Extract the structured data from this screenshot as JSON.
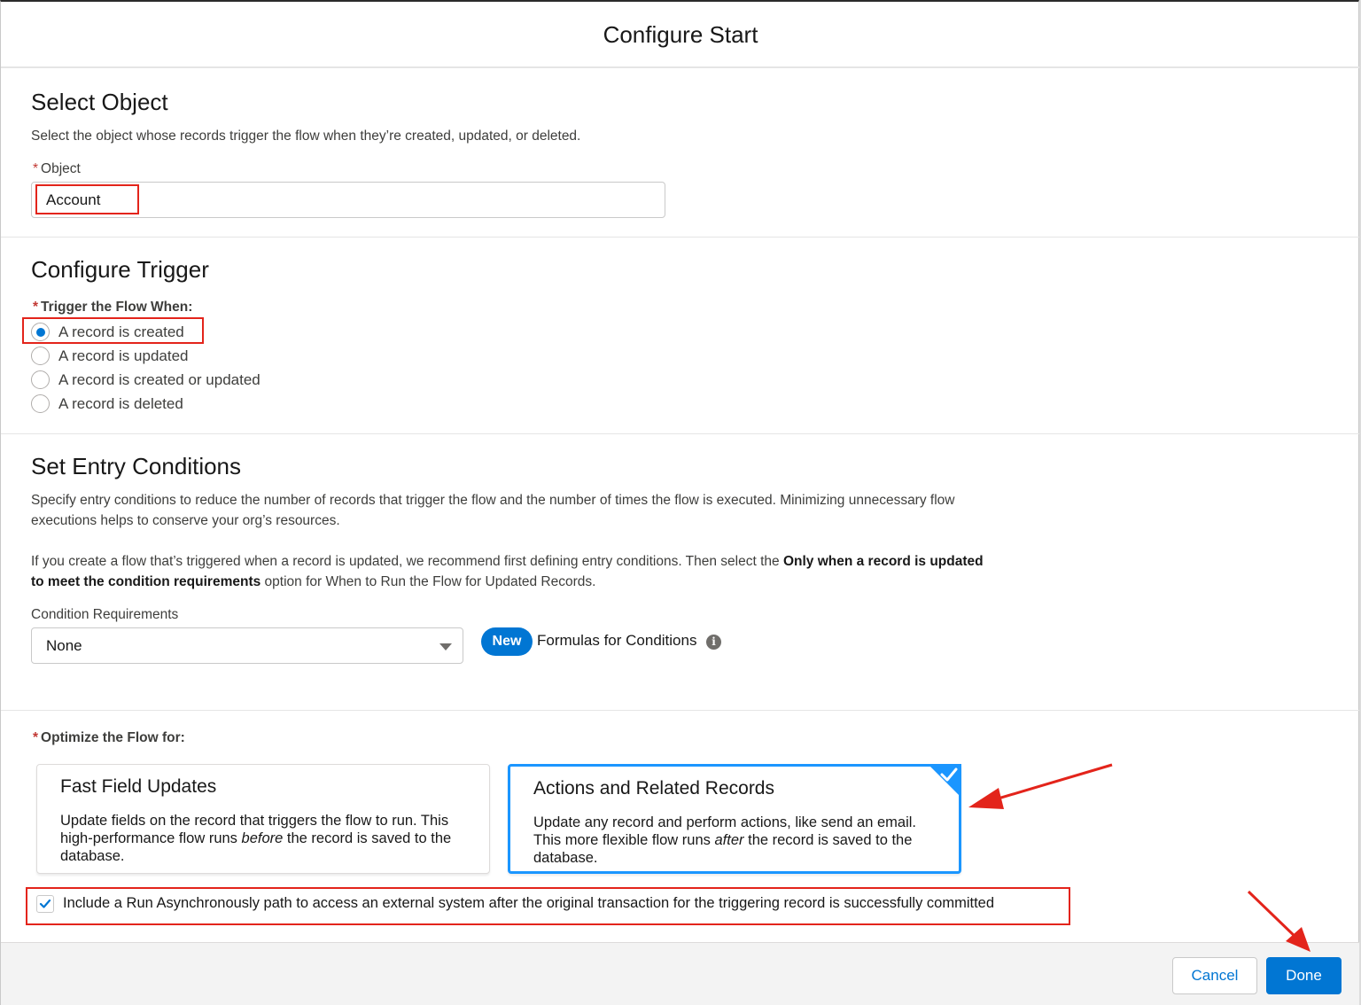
{
  "modal": {
    "title": "Configure Start"
  },
  "select_object": {
    "title": "Select Object",
    "help": "Select the object whose records trigger the flow when they’re created, updated, or deleted.",
    "object_label": "Object",
    "object_value": "Account"
  },
  "trigger": {
    "title": "Configure Trigger",
    "label": "Trigger the Flow When:",
    "options": [
      {
        "label": "A record is created",
        "checked": true
      },
      {
        "label": "A record is updated",
        "checked": false
      },
      {
        "label": "A record is created or updated",
        "checked": false
      },
      {
        "label": "A record is deleted",
        "checked": false
      }
    ]
  },
  "entry": {
    "title": "Set Entry Conditions",
    "help1": "Specify entry conditions to reduce the number of records that trigger the flow and the number of times the flow is executed. Minimizing unnecessary flow executions helps to conserve your org’s resources.",
    "help2_a": "If you create a flow that’s triggered when a record is updated, we recommend first defining entry conditions. Then select the ",
    "help2_bold": "Only when a record is updated to meet the condition requirements",
    "help2_b": " option for When to Run the Flow for Updated Records.",
    "condition_label": "Condition Requirements",
    "condition_value": "None",
    "new_badge": "New",
    "formulas_label": "Formulas for Conditions",
    "info_glyph": "i"
  },
  "optimize": {
    "label": "Optimize the Flow for:",
    "cards": [
      {
        "title": "Fast Field Updates",
        "desc_a": "Update fields on the record that triggers the flow to run. This high-performance flow runs ",
        "desc_em": "before",
        "desc_b": " the record is saved to the database.",
        "selected": false
      },
      {
        "title": "Actions and Related Records",
        "desc_a": "Update any record and perform actions, like send an email. This more flexible flow runs ",
        "desc_em": "after",
        "desc_b": " the record is saved to the database.",
        "selected": true
      }
    ],
    "async_label": "Include a Run Asynchronously path to access an external system after the original transaction for the triggering record is successfully committed",
    "async_checked": true
  },
  "footer": {
    "cancel_label": "Cancel",
    "done_label": "Done"
  },
  "colors": {
    "brand": "#0176d3",
    "selected_border": "#1b96ff",
    "annotation_red": "#e3241b",
    "required": "#c23934"
  }
}
